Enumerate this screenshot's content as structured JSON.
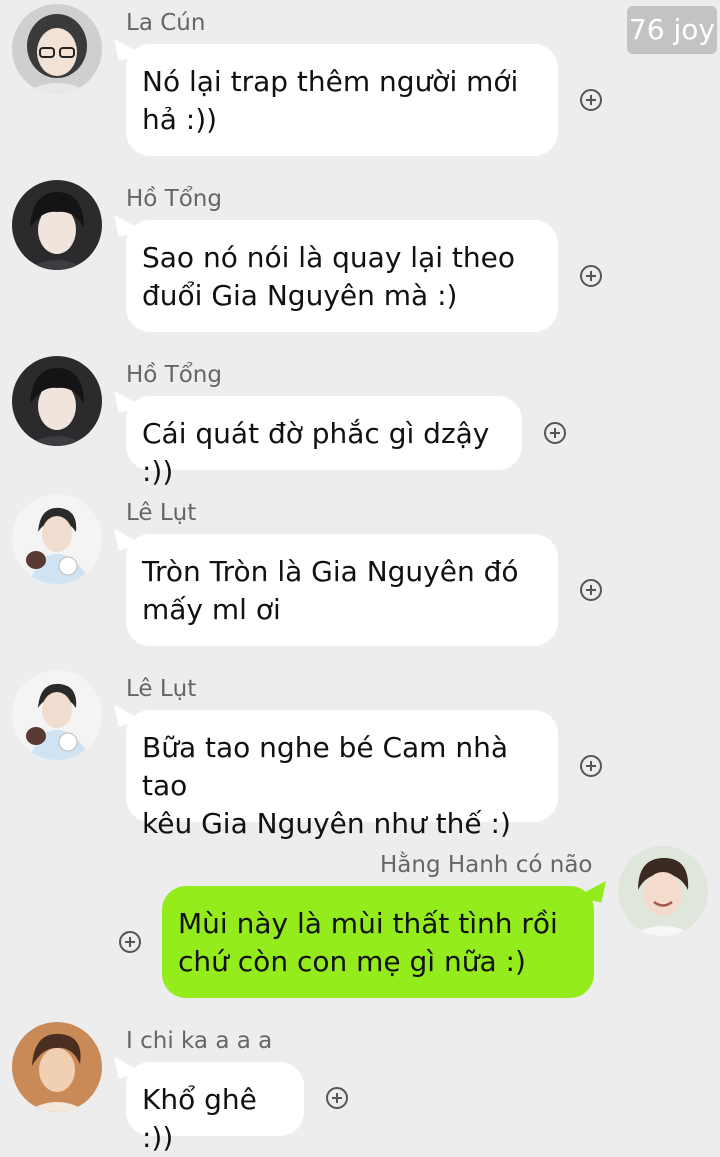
{
  "watermark": "76 joy",
  "messages": [
    {
      "sender": "La Cún",
      "line1": "Nó lại trap thêm người mới",
      "line2": "hả :))",
      "side": "left",
      "avatar_icon": "girl-glasses-avatar"
    },
    {
      "sender": "Hồ Tổng",
      "line1": "Sao nó nói là quay lại theo",
      "line2": "đuổi Gia Nguyên mà :)",
      "side": "left",
      "avatar_icon": "dark-hair-boy-avatar"
    },
    {
      "sender": "Hồ Tổng",
      "line1": "Cái quát đờ phắc gì dzậy :))",
      "line2": "",
      "side": "left",
      "avatar_icon": "dark-hair-boy-avatar"
    },
    {
      "sender": "Lê Lụt",
      "line1": "Tròn Tròn là Gia Nguyên đó",
      "line2": "mấy ml ơi",
      "side": "left",
      "avatar_icon": "boy-with-plush-avatar"
    },
    {
      "sender": "Lê Lụt",
      "line1": "Bữa tao nghe bé Cam nhà tao",
      "line2": "kêu Gia Nguyên như thế :)",
      "side": "left",
      "avatar_icon": "boy-with-plush-avatar"
    },
    {
      "sender": "Hằng Hanh có não",
      "line1": "Mùi này là mùi thất tình rồi",
      "line2": "chứ còn con mẹ gì nữa :)",
      "side": "right",
      "avatar_icon": "smiling-boy-avatar"
    },
    {
      "sender": "I chi ka a a a",
      "line1": "Khổ ghê :))",
      "line2": "",
      "side": "left",
      "avatar_icon": "warm-tone-boy-avatar"
    }
  ],
  "colors": {
    "background": "#ededed",
    "bubble_left": "#ffffff",
    "bubble_right": "#95ec1d",
    "plus_icon": "#555555"
  }
}
